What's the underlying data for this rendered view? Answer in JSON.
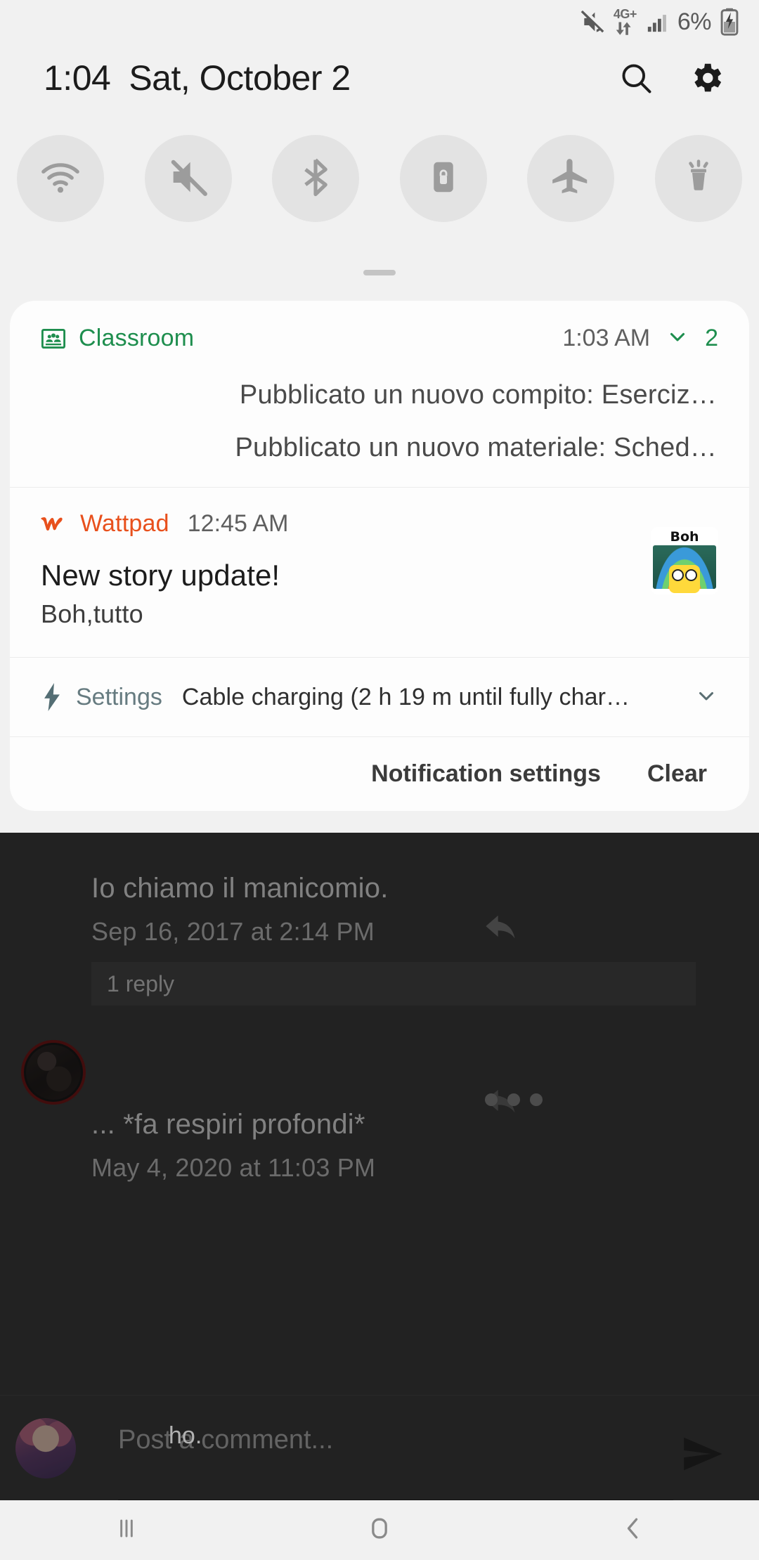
{
  "status_bar": {
    "mute_icon": "mute-icon",
    "network_label": "4G+",
    "data_arrows_icon": "data-transfer-icon",
    "signal_icon": "signal-bars-icon",
    "battery_percent": "6%",
    "battery_icon": "battery-charging-icon"
  },
  "shade_header": {
    "time": "1:04",
    "date": "Sat, October 2",
    "search_icon": "search-icon",
    "settings_icon": "gear-icon"
  },
  "quick_settings": [
    {
      "name": "wifi",
      "icon": "wifi-icon",
      "state": "off"
    },
    {
      "name": "sound",
      "icon": "mute-icon",
      "state": "off"
    },
    {
      "name": "bluetooth",
      "icon": "bluetooth-icon",
      "state": "off"
    },
    {
      "name": "auto-rotate",
      "icon": "rotation-lock-icon",
      "state": "off"
    },
    {
      "name": "airplane-mode",
      "icon": "airplane-icon",
      "state": "off"
    },
    {
      "name": "flashlight",
      "icon": "flashlight-icon",
      "state": "off"
    }
  ],
  "notifications": [
    {
      "app": "Classroom",
      "app_color": "#1e8e4e",
      "time": "1:03 AM",
      "count": "2",
      "expand_icon": "chevron-down-icon",
      "lines": [
        "Pubblicato un nuovo compito: Eserciz…",
        "Pubblicato un nuovo materiale: Sched…"
      ]
    },
    {
      "app": "Wattpad",
      "app_color": "#e8501c",
      "time": "12:45 AM",
      "title": "New story update!",
      "body": "Boh,tutto",
      "thumbnail_caption": "Boh"
    },
    {
      "app": "Settings",
      "app_color": "#667b80",
      "icon": "bolt-icon",
      "body": "Cable charging (2 h 19 m until fully char…",
      "expand_icon": "chevron-down-icon"
    }
  ],
  "panel_footer": {
    "notification_settings": "Notification settings",
    "clear": "Clear"
  },
  "background_app": {
    "comments": [
      {
        "text": "Io chiamo il manicomio.",
        "date": "Sep 16, 2017 at 2:14 PM",
        "replies": "1 reply",
        "reply_icon": "reply-arrow-icon"
      },
      {
        "text": "... *fa respiri profondi*",
        "date": "May 4, 2020 at 11:03 PM",
        "menu_icon": "overflow-menu-icon",
        "reply_icon": "reply-arrow-icon",
        "avatar": "user-avatar"
      }
    ],
    "composer": {
      "placeholder": "Post a comment...",
      "typed_text": "ho.",
      "send_icon": "send-icon",
      "avatar": "user-avatar"
    }
  },
  "nav_bar": {
    "recents_icon": "recents-icon",
    "home_icon": "home-icon",
    "back_icon": "back-icon"
  },
  "colors": {
    "shade_bg": "#f1f1f1",
    "panel_bg": "#fdfdfd",
    "classroom_green": "#1e8e4e",
    "wattpad_orange": "#e8501c",
    "settings_teal": "#667b80",
    "dim_overlay": "rgba(0,0,0,0.30)"
  }
}
